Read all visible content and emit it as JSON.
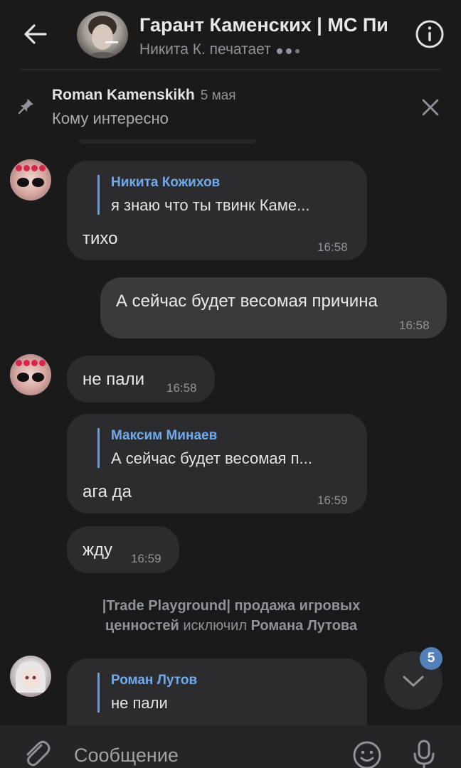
{
  "header": {
    "title": "Гарант Каменских | МС Пи",
    "status_prefix": "Никита К. печатает"
  },
  "pinned": {
    "author": "Roman Kamenskikh",
    "date": "5 мая",
    "text": "Кому интересно"
  },
  "messages": [
    {
      "reply_name": "Никита Кожихов",
      "reply_text": "я знаю что ты твинк Каме...",
      "text": "тихо",
      "time": "16:58"
    },
    {
      "text": "А сейчас будет весомая причина",
      "time": "16:58"
    },
    {
      "text": "не пали",
      "time": "16:58"
    },
    {
      "reply_name": "Максим Минаев",
      "reply_text": "А сейчас будет весомая п...",
      "text": "ага да",
      "time": "16:59"
    },
    {
      "text": "жду",
      "time": "16:59"
    },
    {
      "reply_name": "Роман Лутов",
      "reply_text": "не пали"
    }
  ],
  "service": {
    "actor": "|Trade Playground| продажа игровых ценностей",
    "action": "исключил",
    "target": "Романа Лутова"
  },
  "scroll_badge": "5",
  "composer": {
    "placeholder": "Сообщение"
  },
  "colors": {
    "accent": "#71aaeb",
    "badge": "#5181b8",
    "background": "#1a1a1a",
    "bubble": "#2c2c2e"
  }
}
